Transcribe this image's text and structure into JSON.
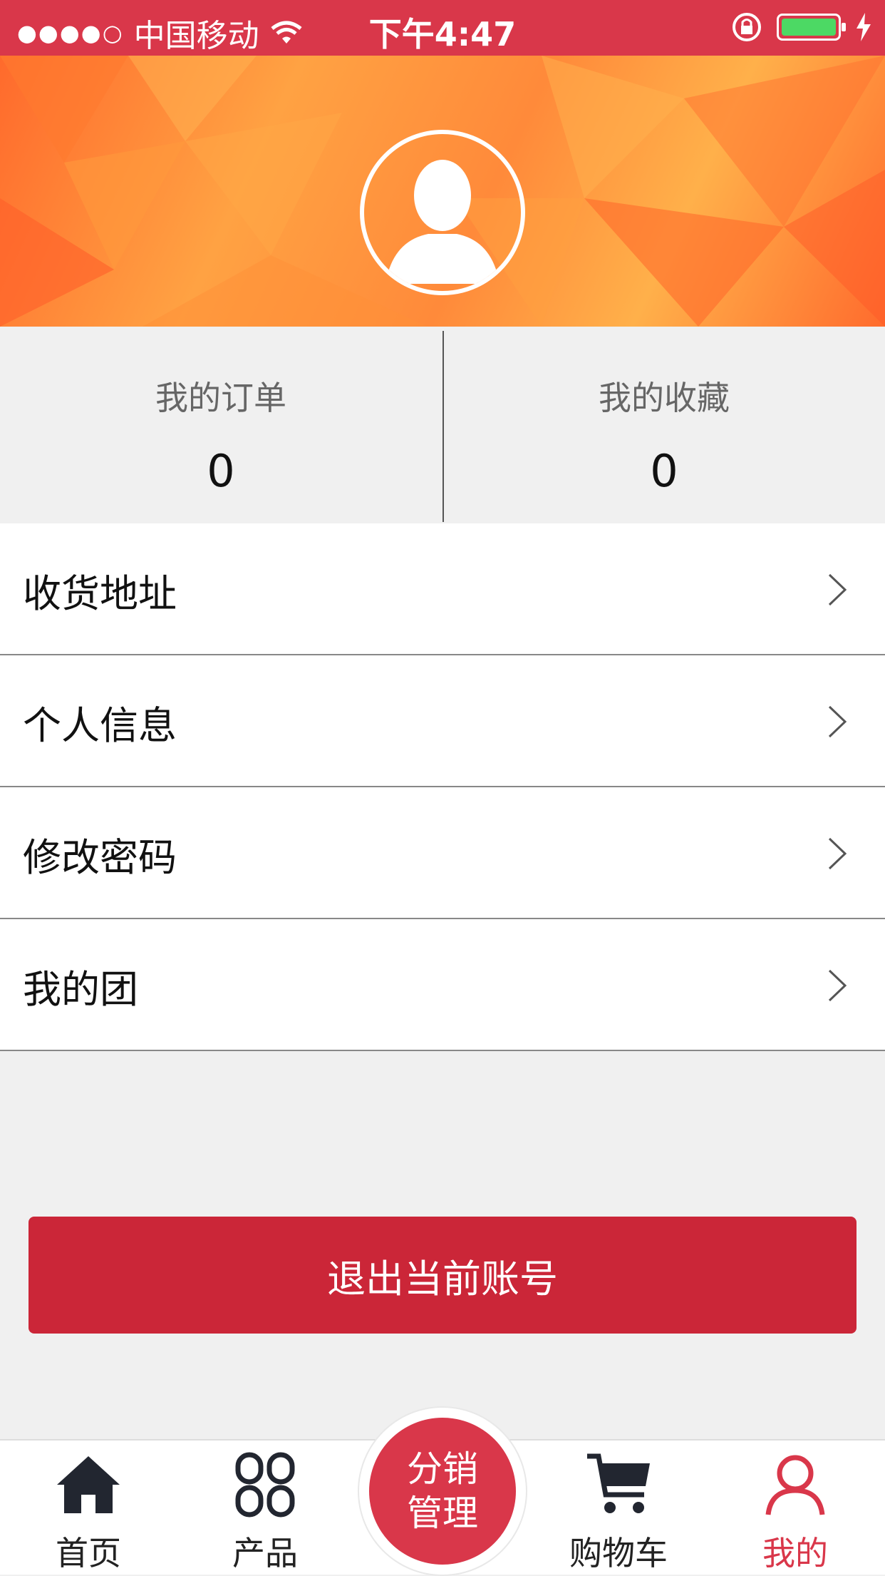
{
  "status_bar": {
    "carrier": "中国移动",
    "time": "下午4:47",
    "signal_dots": "●●●●○"
  },
  "profile": {
    "avatar_icon": "user-silhouette-icon"
  },
  "stats": {
    "orders_label": "我的订单",
    "orders_value": "0",
    "favorites_label": "我的收藏",
    "favorites_value": "0"
  },
  "menu": {
    "items": [
      {
        "label": "收货地址"
      },
      {
        "label": "个人信息"
      },
      {
        "label": "修改密码"
      },
      {
        "label": "我的团"
      }
    ]
  },
  "logout_label": "退出当前账号",
  "tabbar": {
    "home": "首页",
    "products": "产品",
    "center_line1": "分销",
    "center_line2": "管理",
    "cart": "购物车",
    "mine": "我的"
  },
  "colors": {
    "accent": "#d9374a",
    "logout_button": "#cb2638",
    "banner": "#ff8a3a"
  }
}
